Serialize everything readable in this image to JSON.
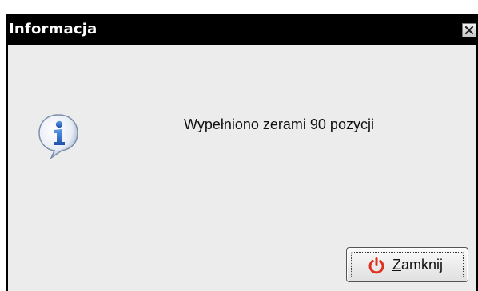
{
  "window": {
    "title": "Informacja",
    "close_icon": "close-icon"
  },
  "body": {
    "icon": "info-icon",
    "message": "Wypełniono zerami 90 pozycji"
  },
  "buttons": {
    "close": {
      "label_first": "Z",
      "label_rest": "amknij",
      "icon": "power-icon"
    }
  },
  "colors": {
    "titlebar": "#000000",
    "content_bg": "#ececec",
    "power_icon": "#e0301e",
    "info_icon_fill": "#4a86d6"
  }
}
